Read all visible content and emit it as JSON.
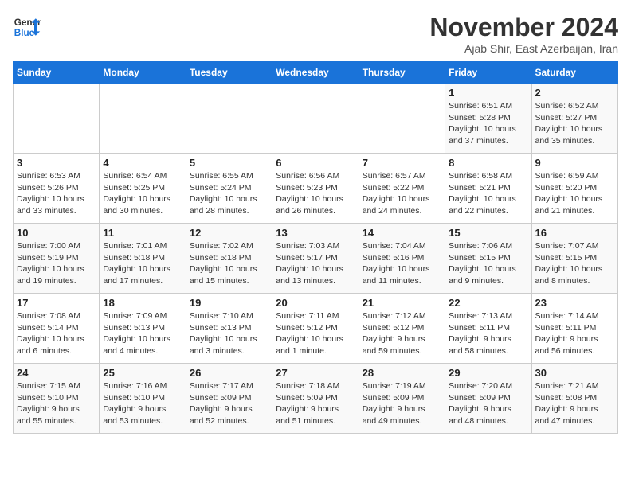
{
  "header": {
    "logo_line1": "General",
    "logo_line2": "Blue",
    "month_title": "November 2024",
    "subtitle": "Ajab Shir, East Azerbaijan, Iran"
  },
  "weekdays": [
    "Sunday",
    "Monday",
    "Tuesday",
    "Wednesday",
    "Thursday",
    "Friday",
    "Saturday"
  ],
  "weeks": [
    [
      {
        "day": "",
        "info": ""
      },
      {
        "day": "",
        "info": ""
      },
      {
        "day": "",
        "info": ""
      },
      {
        "day": "",
        "info": ""
      },
      {
        "day": "",
        "info": ""
      },
      {
        "day": "1",
        "info": "Sunrise: 6:51 AM\nSunset: 5:28 PM\nDaylight: 10 hours\nand 37 minutes."
      },
      {
        "day": "2",
        "info": "Sunrise: 6:52 AM\nSunset: 5:27 PM\nDaylight: 10 hours\nand 35 minutes."
      }
    ],
    [
      {
        "day": "3",
        "info": "Sunrise: 6:53 AM\nSunset: 5:26 PM\nDaylight: 10 hours\nand 33 minutes."
      },
      {
        "day": "4",
        "info": "Sunrise: 6:54 AM\nSunset: 5:25 PM\nDaylight: 10 hours\nand 30 minutes."
      },
      {
        "day": "5",
        "info": "Sunrise: 6:55 AM\nSunset: 5:24 PM\nDaylight: 10 hours\nand 28 minutes."
      },
      {
        "day": "6",
        "info": "Sunrise: 6:56 AM\nSunset: 5:23 PM\nDaylight: 10 hours\nand 26 minutes."
      },
      {
        "day": "7",
        "info": "Sunrise: 6:57 AM\nSunset: 5:22 PM\nDaylight: 10 hours\nand 24 minutes."
      },
      {
        "day": "8",
        "info": "Sunrise: 6:58 AM\nSunset: 5:21 PM\nDaylight: 10 hours\nand 22 minutes."
      },
      {
        "day": "9",
        "info": "Sunrise: 6:59 AM\nSunset: 5:20 PM\nDaylight: 10 hours\nand 21 minutes."
      }
    ],
    [
      {
        "day": "10",
        "info": "Sunrise: 7:00 AM\nSunset: 5:19 PM\nDaylight: 10 hours\nand 19 minutes."
      },
      {
        "day": "11",
        "info": "Sunrise: 7:01 AM\nSunset: 5:18 PM\nDaylight: 10 hours\nand 17 minutes."
      },
      {
        "day": "12",
        "info": "Sunrise: 7:02 AM\nSunset: 5:18 PM\nDaylight: 10 hours\nand 15 minutes."
      },
      {
        "day": "13",
        "info": "Sunrise: 7:03 AM\nSunset: 5:17 PM\nDaylight: 10 hours\nand 13 minutes."
      },
      {
        "day": "14",
        "info": "Sunrise: 7:04 AM\nSunset: 5:16 PM\nDaylight: 10 hours\nand 11 minutes."
      },
      {
        "day": "15",
        "info": "Sunrise: 7:06 AM\nSunset: 5:15 PM\nDaylight: 10 hours\nand 9 minutes."
      },
      {
        "day": "16",
        "info": "Sunrise: 7:07 AM\nSunset: 5:15 PM\nDaylight: 10 hours\nand 8 minutes."
      }
    ],
    [
      {
        "day": "17",
        "info": "Sunrise: 7:08 AM\nSunset: 5:14 PM\nDaylight: 10 hours\nand 6 minutes."
      },
      {
        "day": "18",
        "info": "Sunrise: 7:09 AM\nSunset: 5:13 PM\nDaylight: 10 hours\nand 4 minutes."
      },
      {
        "day": "19",
        "info": "Sunrise: 7:10 AM\nSunset: 5:13 PM\nDaylight: 10 hours\nand 3 minutes."
      },
      {
        "day": "20",
        "info": "Sunrise: 7:11 AM\nSunset: 5:12 PM\nDaylight: 10 hours\nand 1 minute."
      },
      {
        "day": "21",
        "info": "Sunrise: 7:12 AM\nSunset: 5:12 PM\nDaylight: 9 hours\nand 59 minutes."
      },
      {
        "day": "22",
        "info": "Sunrise: 7:13 AM\nSunset: 5:11 PM\nDaylight: 9 hours\nand 58 minutes."
      },
      {
        "day": "23",
        "info": "Sunrise: 7:14 AM\nSunset: 5:11 PM\nDaylight: 9 hours\nand 56 minutes."
      }
    ],
    [
      {
        "day": "24",
        "info": "Sunrise: 7:15 AM\nSunset: 5:10 PM\nDaylight: 9 hours\nand 55 minutes."
      },
      {
        "day": "25",
        "info": "Sunrise: 7:16 AM\nSunset: 5:10 PM\nDaylight: 9 hours\nand 53 minutes."
      },
      {
        "day": "26",
        "info": "Sunrise: 7:17 AM\nSunset: 5:09 PM\nDaylight: 9 hours\nand 52 minutes."
      },
      {
        "day": "27",
        "info": "Sunrise: 7:18 AM\nSunset: 5:09 PM\nDaylight: 9 hours\nand 51 minutes."
      },
      {
        "day": "28",
        "info": "Sunrise: 7:19 AM\nSunset: 5:09 PM\nDaylight: 9 hours\nand 49 minutes."
      },
      {
        "day": "29",
        "info": "Sunrise: 7:20 AM\nSunset: 5:09 PM\nDaylight: 9 hours\nand 48 minutes."
      },
      {
        "day": "30",
        "info": "Sunrise: 7:21 AM\nSunset: 5:08 PM\nDaylight: 9 hours\nand 47 minutes."
      }
    ]
  ]
}
